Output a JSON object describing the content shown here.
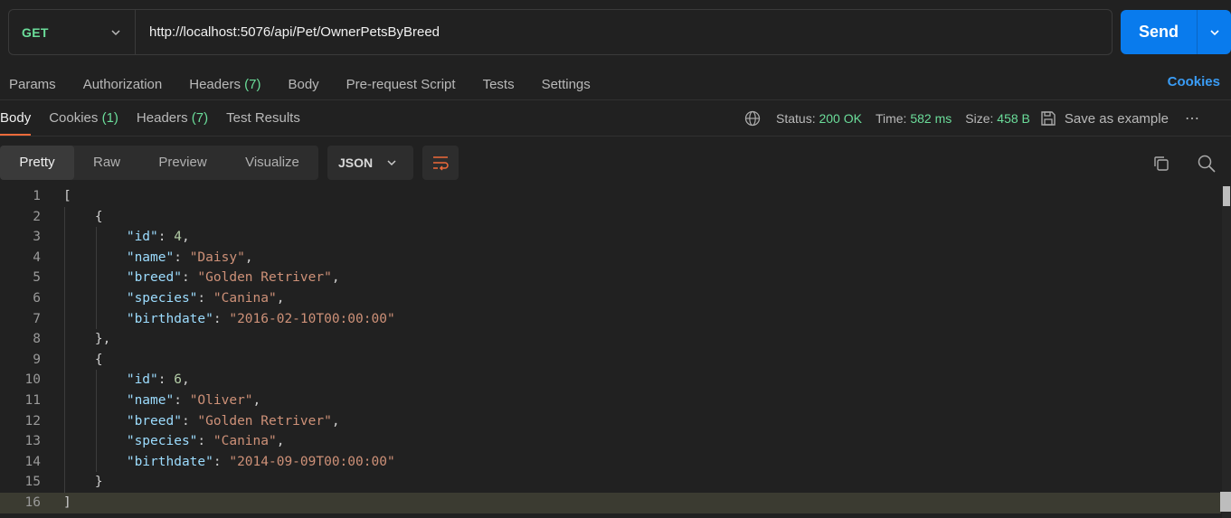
{
  "request": {
    "method": "GET",
    "url": "http://localhost:5076/api/Pet/OwnerPetsByBreed",
    "send_label": "Send"
  },
  "request_tabs": [
    {
      "label": "Params",
      "count": ""
    },
    {
      "label": "Authorization",
      "count": ""
    },
    {
      "label": "Headers",
      "count": "(7)"
    },
    {
      "label": "Body",
      "count": ""
    },
    {
      "label": "Pre-request Script",
      "count": ""
    },
    {
      "label": "Tests",
      "count": ""
    },
    {
      "label": "Settings",
      "count": ""
    }
  ],
  "cookies_link": "Cookies",
  "response_tabs": [
    {
      "label": "Body",
      "count": "",
      "active": true
    },
    {
      "label": "Cookies",
      "count": "(1)",
      "active": false
    },
    {
      "label": "Headers",
      "count": "(7)",
      "active": false
    },
    {
      "label": "Test Results",
      "count": "",
      "active": false
    }
  ],
  "status": {
    "status_label": "Status:",
    "status_value": "200 OK",
    "time_label": "Time:",
    "time_value": "582 ms",
    "size_label": "Size:",
    "size_value": "458 B",
    "save_example": "Save as example",
    "more": "⋯"
  },
  "view_modes": [
    "Pretty",
    "Raw",
    "Preview",
    "Visualize"
  ],
  "active_view": "Pretty",
  "format": "JSON",
  "code_lines": [
    "[",
    "    {",
    "        \"id\": 4,",
    "        \"name\": \"Daisy\",",
    "        \"breed\": \"Golden Retriver\",",
    "        \"species\": \"Canina\",",
    "        \"birthdate\": \"2016-02-10T00:00:00\"",
    "    },",
    "    {",
    "        \"id\": 6,",
    "        \"name\": \"Oliver\",",
    "        \"breed\": \"Golden Retriver\",",
    "        \"species\": \"Canina\",",
    "        \"birthdate\": \"2014-09-09T00:00:00\"",
    "    }",
    "]"
  ],
  "colors": {
    "method": "#6bdd9a",
    "send": "#097bed",
    "accent_tab": "#ef6a3a",
    "json_key": "#9cdcfe",
    "json_string": "#ce9178",
    "json_number": "#b5cea8"
  }
}
